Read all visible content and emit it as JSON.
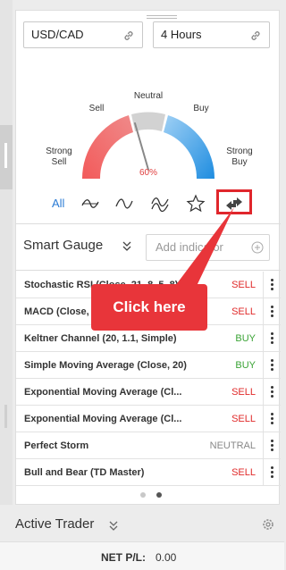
{
  "symbol_field": {
    "value": "USD/CAD",
    "icon": "link-icon"
  },
  "timeframe_field": {
    "value": "4 Hours",
    "icon": "link-icon"
  },
  "gauge": {
    "labels": {
      "strong_sell": "Strong\nSell",
      "sell": "Sell",
      "neutral": "Neutral",
      "buy": "Buy",
      "strong_buy": "Strong\nBuy"
    },
    "value_text": "60%",
    "level_percent": 60,
    "colors": {
      "sell": "#ef4d4d",
      "neutral": "#d0d0d0",
      "buy": "#3ea0e8"
    }
  },
  "style_tabs": {
    "all_label": "All",
    "icons": [
      "trend-line-icon",
      "sine-wave-icon",
      "double-wave-icon",
      "star-icon",
      "swap-arrows-icon"
    ]
  },
  "gauge_select": {
    "label": "Smart Gauge",
    "icon": "chevron-double-down-icon"
  },
  "add_indicator": {
    "placeholder": "Add indicator",
    "icon": "plus-circle-icon"
  },
  "indicators": [
    {
      "name": "Stochastic RSI (Close, 21, 8, 5, 8)",
      "signal": "SELL"
    },
    {
      "name": "MACD (Close, 12, 26, 9)",
      "signal": "SELL"
    },
    {
      "name": "Keltner Channel (20, 1.1, Simple)",
      "signal": "BUY"
    },
    {
      "name": "Simple Moving Average (Close, 20)",
      "signal": "BUY"
    },
    {
      "name": "Exponential Moving Average (Cl...",
      "signal": "SELL"
    },
    {
      "name": "Exponential Moving Average (Cl...",
      "signal": "SELL"
    },
    {
      "name": "Perfect Storm",
      "signal": "NEUTRAL"
    },
    {
      "name": "Bull and Bear (TD Master)",
      "signal": "SELL"
    }
  ],
  "pagination": {
    "pages": 2,
    "active": 2
  },
  "callout": {
    "text": "Click here",
    "color": "#e8353a"
  },
  "active_trader": {
    "title": "Active Trader",
    "icon": "chevron-double-down-icon",
    "settings_icon": "gear-icon"
  },
  "footer": {
    "label": "NET P/L:",
    "value": "0.00"
  }
}
